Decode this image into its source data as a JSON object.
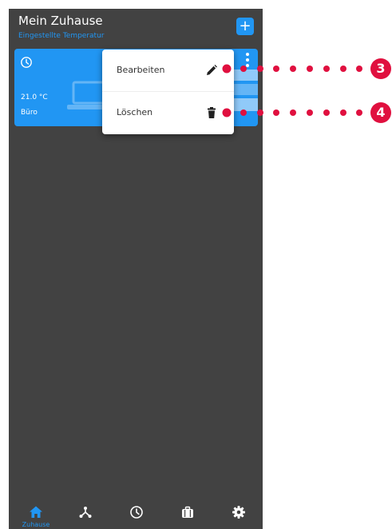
{
  "header": {
    "title": "Mein Zuhause",
    "subtitle": "Eingestellte Temperatur",
    "add_label": "+"
  },
  "room_card": {
    "temperature": "21.0 °C",
    "room_name": "Büro"
  },
  "context_menu": {
    "items": [
      {
        "label": "Bearbeiten",
        "icon": "pencil-icon"
      },
      {
        "label": "Löschen",
        "icon": "trash-icon"
      }
    ]
  },
  "bottom_nav": {
    "items": [
      {
        "label": "Zuhause",
        "icon": "home-icon",
        "active": true
      },
      {
        "label": "",
        "icon": "network-icon",
        "active": false
      },
      {
        "label": "",
        "icon": "clock-icon",
        "active": false
      },
      {
        "label": "",
        "icon": "suitcase-icon",
        "active": false
      },
      {
        "label": "",
        "icon": "gear-icon",
        "active": false
      }
    ]
  },
  "callouts": [
    {
      "number": "3",
      "target": "Bearbeiten"
    },
    {
      "number": "4",
      "target": "Löschen"
    }
  ],
  "colors": {
    "accent": "#2196f3",
    "background": "#424242",
    "callout": "#e0103f",
    "menu_background": "#ffffff"
  }
}
